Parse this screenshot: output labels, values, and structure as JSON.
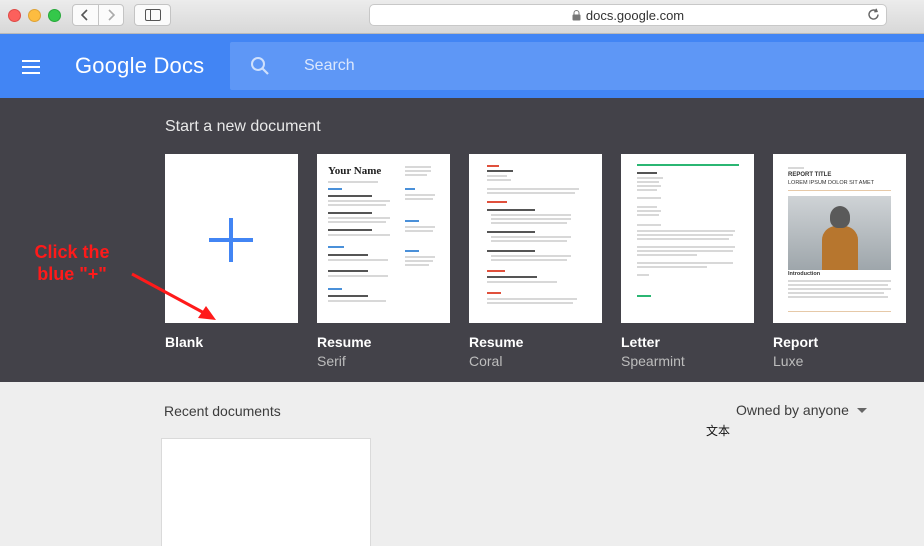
{
  "browser": {
    "url": "docs.google.com"
  },
  "header": {
    "logo_text": "Google Docs",
    "search_placeholder": "Search"
  },
  "templates": {
    "heading": "Start a new document",
    "items": [
      {
        "name": "Blank",
        "subtitle": ""
      },
      {
        "name": "Resume",
        "subtitle": "Serif"
      },
      {
        "name": "Resume",
        "subtitle": "Coral"
      },
      {
        "name": "Letter",
        "subtitle": "Spearmint"
      },
      {
        "name": "Report",
        "subtitle": "Luxe"
      }
    ],
    "thumb_text": {
      "resume_serif_name": "Your Name",
      "report_title": "REPORT TITLE",
      "report_subtitle": "LOREM IPSUM DOLOR SIT AMET",
      "report_intro": "Introduction"
    }
  },
  "annotation": {
    "callout_text": "Click the blue \"+\"",
    "color": "#ff1a1a"
  },
  "recent": {
    "label": "Recent documents",
    "owner_filter": "Owned by anyone",
    "overlay_text": "文本"
  },
  "colors": {
    "accent": "#4285f4",
    "template_band": "#434249"
  }
}
